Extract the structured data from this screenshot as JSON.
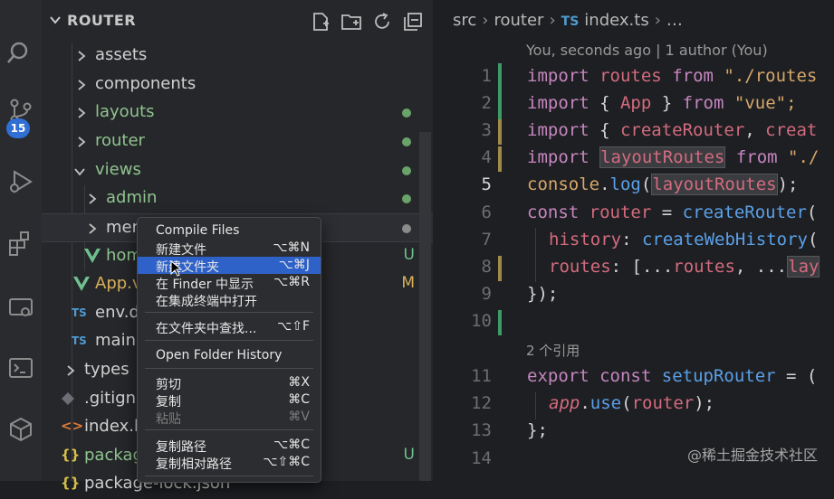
{
  "explorer": {
    "title": "ROUTER",
    "items": [
      {
        "label": "assets"
      },
      {
        "label": "components"
      },
      {
        "label": "layouts"
      },
      {
        "label": "router"
      },
      {
        "label": "views"
      },
      {
        "label": "admin"
      },
      {
        "label": "menu"
      },
      {
        "label": "home",
        "status": "U"
      },
      {
        "label": "App.vue",
        "status": "M"
      },
      {
        "label": "env.d.ts"
      },
      {
        "label": "main.ts"
      },
      {
        "label": "types"
      },
      {
        "label": ".gitignore"
      },
      {
        "label": "index.html"
      },
      {
        "label": "package.json",
        "status": "U"
      },
      {
        "label": "package-lock.json"
      }
    ],
    "scm_badge": "15"
  },
  "editor": {
    "breadcrumb": {
      "p1": "src",
      "p2": "router",
      "ts": "TS",
      "file": "index.ts",
      "more": "…"
    },
    "blame": "You, seconds ago | 1 author (You)",
    "refs": "2 个引用",
    "lines": [
      "1",
      "2",
      "3",
      "4",
      "5",
      "6",
      "7",
      "8",
      "9",
      "10",
      "11",
      "12",
      "13",
      "14"
    ],
    "code": {
      "l1": {
        "kw": "import",
        "a": "routes",
        "b": "from",
        "c": "\"./routes"
      },
      "l2": {
        "kw": "import",
        "a": "{ ",
        "b": "App",
        "c": " }",
        "d": "from",
        "e": "\"vue\";"
      },
      "l3": {
        "kw": "import",
        "a": "{ ",
        "b": "createRouter",
        "c": ", ",
        "d": "creat"
      },
      "l4": {
        "kw": "import",
        "a": "layoutRoutes",
        "b": "from",
        "c": "\"./"
      },
      "l5": {
        "a": "console",
        "b": ".",
        "c": "log",
        "d": "(",
        "e": "layoutRoutes",
        "f": ");"
      },
      "l6": {
        "kw": "const",
        "a": "router",
        "b": " = ",
        "c": "createRouter",
        "d": "("
      },
      "l7": {
        "a": "history",
        "b": ": ",
        "c": "createWebHistory",
        "d": "("
      },
      "l8": {
        "a": "routes",
        "b": ": [...",
        "c": "routes",
        "d": ", ...",
        "e": "lay"
      },
      "l9": {
        "a": "});"
      },
      "l11": {
        "kw": "export",
        "a": "const",
        "b": "setupRouter",
        "c": " = ("
      },
      "l12": {
        "a": "app",
        "b": ".",
        "c": "use",
        "d": "(",
        "e": "router",
        "f": ");"
      },
      "l13": {
        "a": "};"
      }
    }
  },
  "menu": {
    "items": [
      {
        "label": "Compile Files",
        "shortcut": ""
      },
      {
        "label": "新建文件",
        "shortcut": "⌥⌘N"
      },
      {
        "label": "新建文件夹",
        "shortcut": "⌥⌘J"
      },
      {
        "label": "在 Finder 中显示",
        "shortcut": "⌥⌘R"
      },
      {
        "label": "在集成终端中打开",
        "shortcut": ""
      },
      {
        "label": "在文件夹中查找...",
        "shortcut": "⌥⇧F"
      },
      {
        "label": "Open Folder History",
        "shortcut": ""
      },
      {
        "label": "剪切",
        "shortcut": "⌘X"
      },
      {
        "label": "复制",
        "shortcut": "⌘C"
      },
      {
        "label": "粘贴",
        "shortcut": "⌘V"
      },
      {
        "label": "复制路径",
        "shortcut": "⌥⌘C"
      },
      {
        "label": "复制相对路径",
        "shortcut": "⌥⇧⌘C"
      }
    ]
  },
  "watermark": "@稀土掘金技术社区",
  "colors": {
    "accent": "#2f62c8",
    "git_added": "#6aa36a",
    "badge": "#2f6fd6"
  }
}
